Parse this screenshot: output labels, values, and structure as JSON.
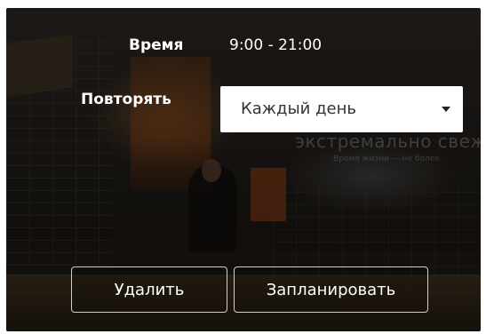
{
  "schedule": {
    "time_label": "Время",
    "time_value": "9:00  - 21:00",
    "repeat_label": "Повторять",
    "repeat_selected": "Каждый день"
  },
  "background": {
    "wall_sign": "экстремально свежо",
    "wall_sign_sub": "Время жизни — не более"
  },
  "actions": {
    "delete_label": "Удалить",
    "schedule_label": "Запланировать"
  }
}
